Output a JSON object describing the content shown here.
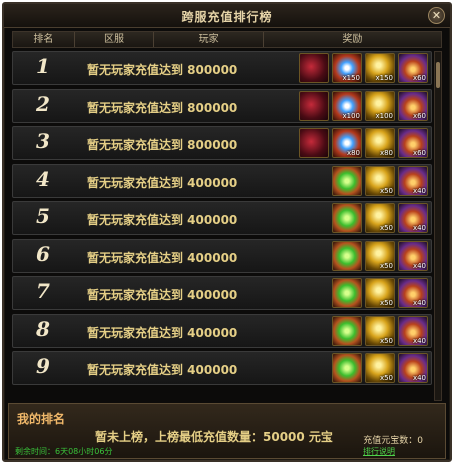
{
  "window": {
    "title": "跨服充值排行榜",
    "close_icon": "close-icon"
  },
  "header": {
    "columns": [
      "排名",
      "区服",
      "玩家",
      "奖励"
    ]
  },
  "rows": [
    {
      "rank": "1",
      "status": "暂无玩家充值达到 800000",
      "rewards": [
        {
          "icon": "weapon-icon",
          "count": ""
        },
        {
          "icon": "gem-icon",
          "count": "x150"
        },
        {
          "icon": "gold-coin-icon",
          "count": "x150"
        },
        {
          "icon": "treasure-chest-icon",
          "count": "x60"
        }
      ]
    },
    {
      "rank": "2",
      "status": "暂无玩家充值达到 800000",
      "rewards": [
        {
          "icon": "weapon-icon",
          "count": ""
        },
        {
          "icon": "gem-icon",
          "count": "x100"
        },
        {
          "icon": "gold-coin-icon",
          "count": "x100"
        },
        {
          "icon": "treasure-chest-icon",
          "count": "x60"
        }
      ]
    },
    {
      "rank": "3",
      "status": "暂无玩家充值达到 800000",
      "rewards": [
        {
          "icon": "weapon-icon",
          "count": ""
        },
        {
          "icon": "gem-icon",
          "count": "x80"
        },
        {
          "icon": "gold-coin-icon",
          "count": "x80"
        },
        {
          "icon": "treasure-chest-icon",
          "count": "x60"
        }
      ]
    },
    {
      "rank": "4",
      "status": "暂无玩家充值达到 400000",
      "rewards": [
        {
          "icon": "green-gem-icon",
          "count": ""
        },
        {
          "icon": "gold-coin-icon",
          "count": "x50"
        },
        {
          "icon": "treasure-chest-icon",
          "count": "x40"
        }
      ]
    },
    {
      "rank": "5",
      "status": "暂无玩家充值达到 400000",
      "rewards": [
        {
          "icon": "green-gem-icon",
          "count": ""
        },
        {
          "icon": "gold-coin-icon",
          "count": "x50"
        },
        {
          "icon": "treasure-chest-icon",
          "count": "x40"
        }
      ]
    },
    {
      "rank": "6",
      "status": "暂无玩家充值达到 400000",
      "rewards": [
        {
          "icon": "green-gem-icon",
          "count": ""
        },
        {
          "icon": "gold-coin-icon",
          "count": "x50"
        },
        {
          "icon": "treasure-chest-icon",
          "count": "x40"
        }
      ]
    },
    {
      "rank": "7",
      "status": "暂无玩家充值达到 400000",
      "rewards": [
        {
          "icon": "green-gem-icon",
          "count": ""
        },
        {
          "icon": "gold-coin-icon",
          "count": "x50"
        },
        {
          "icon": "treasure-chest-icon",
          "count": "x40"
        }
      ]
    },
    {
      "rank": "8",
      "status": "暂无玩家充值达到 400000",
      "rewards": [
        {
          "icon": "green-gem-icon",
          "count": ""
        },
        {
          "icon": "gold-coin-icon",
          "count": "x50"
        },
        {
          "icon": "treasure-chest-icon",
          "count": "x40"
        }
      ]
    },
    {
      "rank": "9",
      "status": "暂无玩家充值达到 400000",
      "rewards": [
        {
          "icon": "green-gem-icon",
          "count": ""
        },
        {
          "icon": "gold-coin-icon",
          "count": "x50"
        },
        {
          "icon": "treasure-chest-icon",
          "count": "x40"
        }
      ]
    }
  ],
  "my_rank": {
    "title": "我的排名",
    "status": "暂未上榜，上榜最低充值数量：50000 元宝",
    "amount": "充值元宝数：0",
    "time_left": "剩余时间：6天08小时06分",
    "explain_link": "排行说明"
  },
  "colors": {
    "accent_gold": "#e5cf86",
    "green_text": "#39c23a",
    "background": "#0c0b0a"
  }
}
